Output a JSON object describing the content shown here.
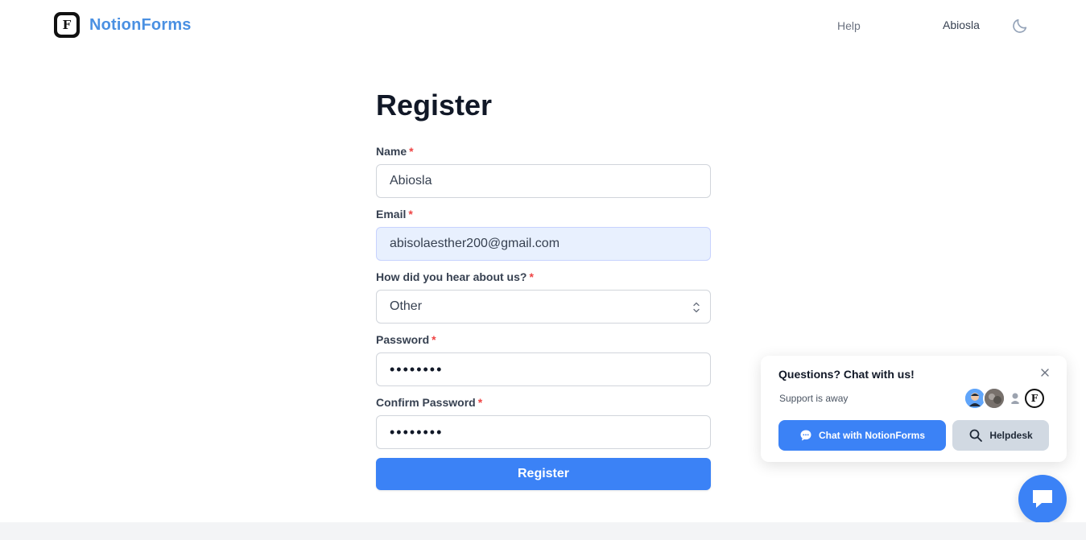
{
  "header": {
    "brand": "NotionForms",
    "logo_letter": "F",
    "help_link": "Help",
    "user_name": "Abiosla",
    "theme_icon": "moon-icon"
  },
  "form": {
    "title": "Register",
    "required_mark": "*",
    "fields": {
      "name": {
        "label": "Name",
        "value": "Abiosla"
      },
      "email": {
        "label": "Email",
        "value": "abisolaesther200@gmail.com"
      },
      "hear_about": {
        "label": "How did you hear about us?",
        "value": "Other"
      },
      "password": {
        "label": "Password",
        "value": "••••••••"
      },
      "confirm_password": {
        "label": "Confirm Password",
        "value": "••••••••"
      }
    },
    "submit_label": "Register"
  },
  "chat_widget": {
    "title": "Questions? Chat with us!",
    "status": "Support is away",
    "close_icon": "close-icon",
    "chat_button": "Chat with NotionForms",
    "helpdesk_button": "Helpdesk",
    "avatar_letter": "F"
  },
  "colors": {
    "accent": "#3b82f6",
    "brand_text": "#4a90e2",
    "required": "#ef4444",
    "autofill_bg": "#e8f0fe"
  }
}
